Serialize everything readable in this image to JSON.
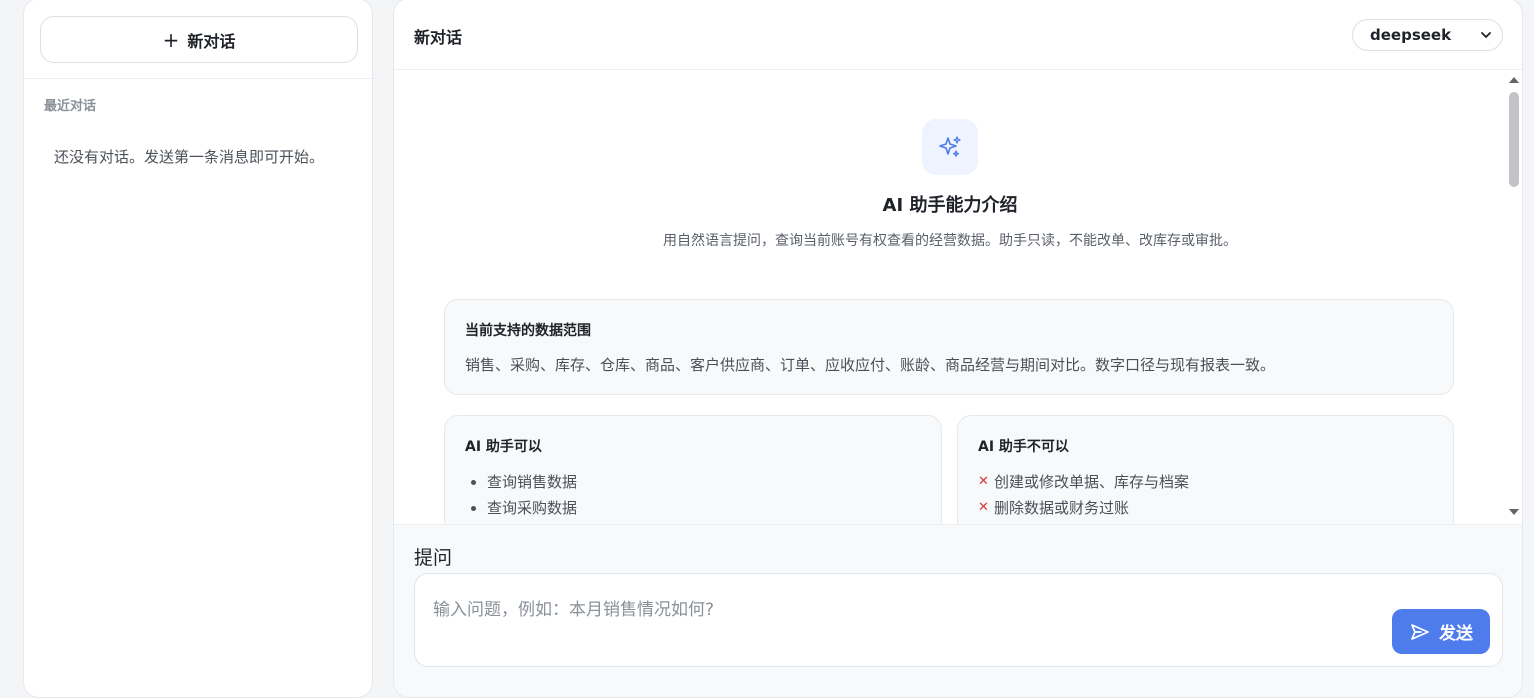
{
  "sidebar": {
    "new_chat_label": "新对话",
    "recent_label": "最近对话",
    "empty_text": "还没有对话。发送第一条消息即可开始。"
  },
  "header": {
    "title": "新对话",
    "model_selected": "deepseek"
  },
  "intro": {
    "title": "AI 助手能力介绍",
    "subtitle": "用自然语言提问，查询当前账号有权查看的经营数据。助手只读，不能改单、改库存或审批。"
  },
  "scope_card": {
    "title": "当前支持的数据范围",
    "text": "销售、采购、库存、仓库、商品、客户供应商、订单、应收应付、账龄、商品经营与期间对比。数字口径与现有报表一致。"
  },
  "can_card": {
    "title": "AI 助手可以",
    "items": [
      "查询销售数据",
      "查询采购数据"
    ]
  },
  "cannot_card": {
    "title": "AI 助手不可以",
    "items": [
      "创建或修改单据、库存与档案",
      "删除数据或财务过账"
    ]
  },
  "composer": {
    "label": "提问",
    "placeholder": "输入问题，例如：本月销售情况如何?",
    "send_label": "发送"
  },
  "colors": {
    "accent": "#4f7cec",
    "danger": "#d43a3a"
  }
}
